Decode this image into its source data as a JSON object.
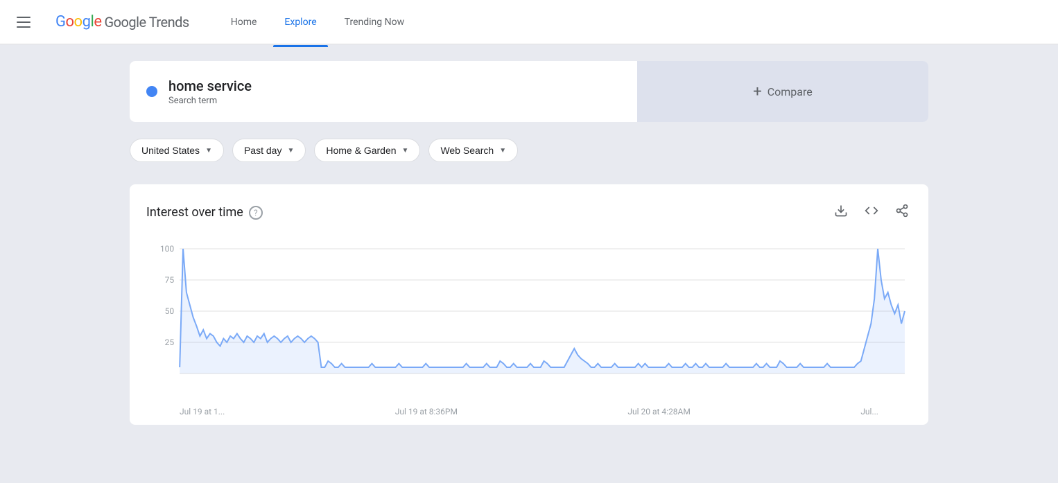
{
  "app": {
    "title": "Google Trends"
  },
  "header": {
    "menu_icon": "menu",
    "logo": {
      "google": "Google",
      "trends": "Trends"
    },
    "nav": [
      {
        "label": "Home",
        "active": false
      },
      {
        "label": "Explore",
        "active": true
      },
      {
        "label": "Trending Now",
        "active": false
      }
    ]
  },
  "search": {
    "term": "home service",
    "type": "Search term",
    "dot_color": "#4285f4"
  },
  "compare": {
    "label": "Compare",
    "plus": "+"
  },
  "filters": [
    {
      "label": "United States",
      "has_dropdown": true
    },
    {
      "label": "Past day",
      "has_dropdown": true
    },
    {
      "label": "Home & Garden",
      "has_dropdown": true
    },
    {
      "label": "Web Search",
      "has_dropdown": true
    }
  ],
  "chart": {
    "title": "Interest over time",
    "help_icon": "?",
    "download_icon": "⬇",
    "embed_icon": "<>",
    "share_icon": "share",
    "y_labels": [
      "100",
      "75",
      "50",
      "25"
    ],
    "x_labels": [
      "Jul 19 at 1...",
      "Jul 19 at 8:36PM",
      "Jul 20 at 4:28AM",
      "Jul..."
    ],
    "line_color": "#7baaf7",
    "grid_color": "#e0e0e0",
    "data_points": [
      5,
      100,
      65,
      55,
      45,
      38,
      30,
      35,
      28,
      32,
      30,
      25,
      22,
      28,
      25,
      30,
      28,
      32,
      28,
      25,
      30,
      28,
      25,
      30,
      28,
      32,
      25,
      28,
      30,
      28,
      25,
      28,
      30,
      25,
      28,
      30,
      28,
      25,
      28,
      30,
      28,
      25,
      5,
      5,
      10,
      8,
      5,
      5,
      8,
      5,
      5,
      5,
      5,
      5,
      5,
      5,
      5,
      8,
      5,
      5,
      5,
      5,
      5,
      5,
      5,
      8,
      5,
      5,
      5,
      5,
      5,
      5,
      5,
      8,
      5,
      5,
      5,
      5,
      5,
      5,
      5,
      5,
      5,
      5,
      5,
      8,
      5,
      5,
      5,
      5,
      5,
      8,
      5,
      5,
      5,
      10,
      8,
      5,
      5,
      8,
      5,
      5,
      5,
      5,
      8,
      5,
      5,
      5,
      10,
      8,
      5,
      5,
      5,
      5,
      5,
      10,
      15,
      20,
      15,
      12,
      10,
      8,
      5,
      5,
      8,
      5,
      5,
      5,
      5,
      8,
      5,
      5,
      5,
      5,
      5,
      5,
      8,
      5,
      8,
      5,
      5,
      5,
      5,
      5,
      5,
      8,
      5,
      5,
      5,
      5,
      8,
      5,
      5,
      8,
      5,
      5,
      8,
      5,
      5,
      5,
      5,
      5,
      8,
      5,
      5,
      5,
      5,
      5,
      5,
      5,
      5,
      8,
      5,
      5,
      8,
      5,
      5,
      5,
      10,
      8,
      5,
      5,
      5,
      5,
      8,
      5,
      5,
      5,
      5,
      5,
      5,
      5,
      8,
      5,
      5,
      5,
      5,
      5,
      5,
      5,
      5,
      8,
      10,
      20,
      30,
      40,
      60,
      100,
      75,
      60,
      65,
      55,
      48,
      55,
      40,
      50
    ]
  }
}
